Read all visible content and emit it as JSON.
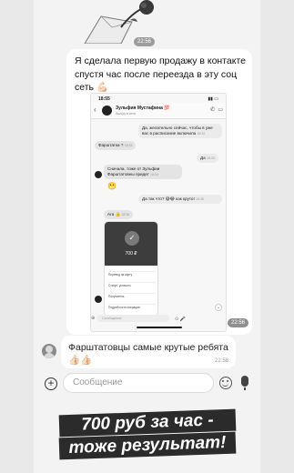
{
  "sticker": {
    "time": "22:56"
  },
  "main_message": {
    "text": "Я сделала первую продажу в контакте спустя час после переезда в эту соц сеть 💪🏻",
    "time": "22:56"
  },
  "screenshot": {
    "status_time": "18:55",
    "status_icons": "▮▮ ▭",
    "contact_name": "Зульфия Мустафина 💯",
    "contact_status": "был(а) в сети",
    "messages": [
      {
        "text": "Да, желательно сейчас, чтобы в уже вас в расписание включила",
        "time": "18:32"
      },
      {
        "text": "Фарштатка ?",
        "time": "18:33"
      },
      {
        "text": "Да",
        "time": "18:33"
      },
      {
        "text": "Сначала, тоже от Зульфии Фарштатовны придет",
        "time": "18:34"
      },
      {
        "text": "😬",
        "time": "18:34"
      },
      {
        "text": "Да так что? 😅😂 как круто!",
        "time": "18:35"
      },
      {
        "text": "Ага 👍",
        "time": "18:36"
      }
    ],
    "card": {
      "check": "✓",
      "amount": "700 ₽",
      "rows": [
        "Перевод на карту",
        "Статус: успешно",
        "Получатель",
        "Подробности операции"
      ]
    },
    "input_placeholder": "Сообщение",
    "footer_icons": "⊙ 🎤",
    "scroll_down": "⌄"
  },
  "second_message": {
    "text": "Фарштатовцы самые крутые ребята 👍🏻👍🏻",
    "time": "22:58"
  },
  "composer": {
    "plus": "+",
    "placeholder": "Сообщение"
  },
  "banner": {
    "line1": "700 руб за час -",
    "line2": "тоже результат!"
  },
  "colors": {
    "background": "#e9e9e9",
    "chat_bg": "#f3f3f3",
    "bubble": "#ffffff",
    "banner_bg": "#2b2b2b"
  }
}
